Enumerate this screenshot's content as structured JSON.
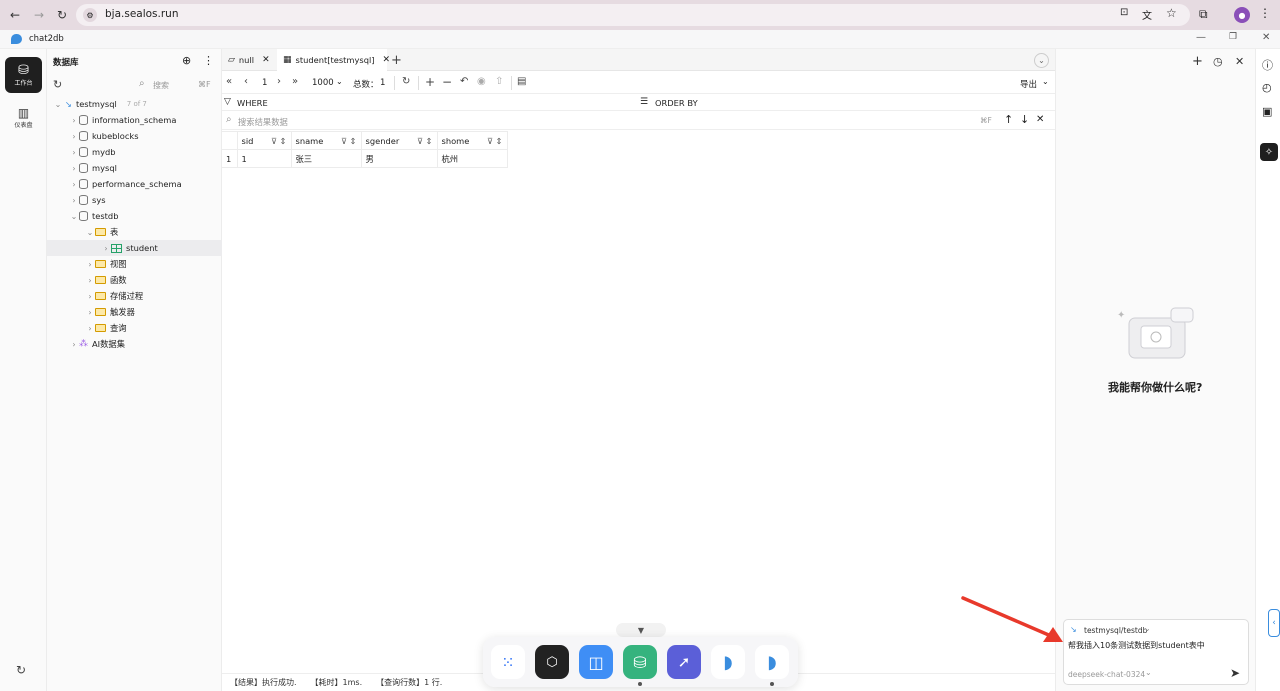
{
  "browser": {
    "url": "bja.sealos.run"
  },
  "app": {
    "title": "chat2db"
  },
  "rail": {
    "items": [
      {
        "label": "工作台"
      },
      {
        "label": "仪表盘"
      }
    ]
  },
  "sidebar": {
    "title": "数据库",
    "search_placeholder": "搜索",
    "search_shortcut": "⌘F",
    "connection": {
      "name": "testmysql",
      "count": "7 of 7"
    },
    "databases": [
      "information_schema",
      "kubeblocks",
      "mydb",
      "mysql",
      "performance_schema",
      "sys",
      "testdb"
    ],
    "testdb_children": [
      {
        "label": "表"
      },
      {
        "label": "student"
      },
      {
        "label": "视图"
      },
      {
        "label": "函数"
      },
      {
        "label": "存储过程"
      },
      {
        "label": "触发器"
      },
      {
        "label": "查询"
      }
    ],
    "ai_dataset": "AI数据集"
  },
  "tabs": [
    {
      "label": "null"
    },
    {
      "label": "student[testmysql]"
    }
  ],
  "toolbar": {
    "page": "1",
    "page_size": "1000",
    "total_label": "总数：",
    "total": "1",
    "export": "导出"
  },
  "filters": {
    "where": "WHERE",
    "order_by": "ORDER BY",
    "search_placeholder": "搜索结果数据",
    "search_shortcut": "⌘F"
  },
  "table": {
    "columns": [
      "sid",
      "sname",
      "sgender",
      "shome"
    ],
    "rows": [
      {
        "index": "1",
        "cells": [
          "1",
          "张三",
          "男",
          "杭州"
        ]
      }
    ]
  },
  "status": {
    "result": "【结果】执行成功.",
    "time": "【耗时】1ms.",
    "rows": "【查询行数】1 行."
  },
  "chat": {
    "prompt": "我能帮你做什么呢?",
    "context": "testmysql/testdb",
    "input_value": "帮我插入10条测试数据到student表中",
    "model": "deepseek-chat-0324"
  },
  "colors": {
    "accent": "#1677ff",
    "annotation_arrow": "#e8392b"
  }
}
